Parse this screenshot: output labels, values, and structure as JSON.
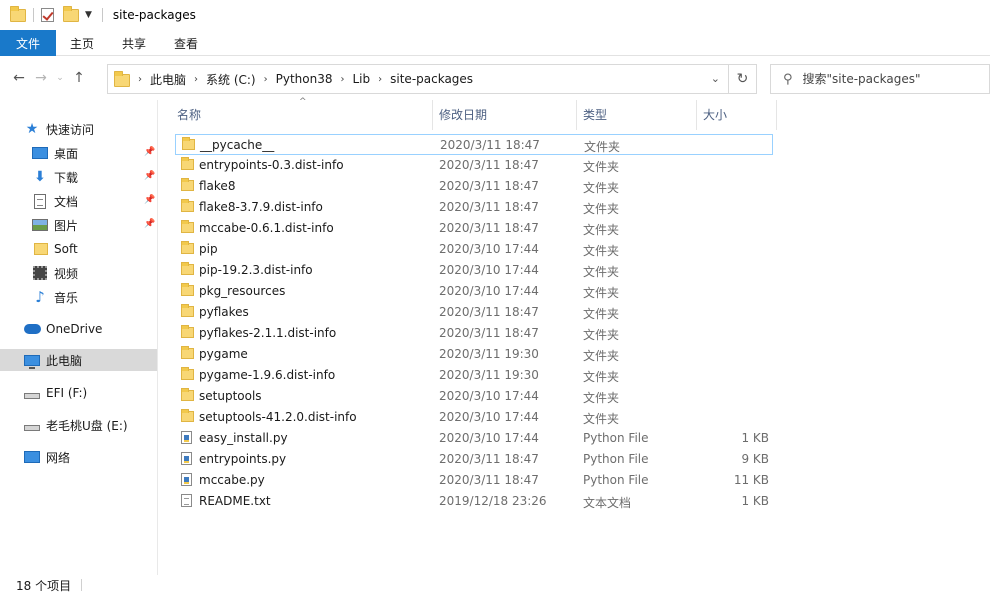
{
  "window": {
    "title": "site-packages"
  },
  "ribbon": {
    "tabs": [
      "文件",
      "主页",
      "共享",
      "查看"
    ]
  },
  "address": {
    "crumbs": [
      "此电脑",
      "系统 (C:)",
      "Python38",
      "Lib",
      "site-packages"
    ]
  },
  "search": {
    "placeholder": "搜索\"site-packages\""
  },
  "nav": {
    "quick_access": "快速访问",
    "items": [
      "桌面",
      "下载",
      "文档",
      "图片",
      "Soft",
      "视频",
      "音乐"
    ],
    "onedrive": "OneDrive",
    "this_pc": "此电脑",
    "drive_f": "EFI (F:)",
    "drive_e": "老毛桃U盘 (E:)",
    "network": "网络"
  },
  "columns": {
    "name": "名称",
    "date": "修改日期",
    "type": "类型",
    "size": "大小"
  },
  "files": [
    {
      "name": "__pycache__",
      "date": "2020/3/11 18:47",
      "type": "文件夹",
      "size": "",
      "icon": "folder"
    },
    {
      "name": "entrypoints-0.3.dist-info",
      "date": "2020/3/11 18:47",
      "type": "文件夹",
      "size": "",
      "icon": "folder"
    },
    {
      "name": "flake8",
      "date": "2020/3/11 18:47",
      "type": "文件夹",
      "size": "",
      "icon": "folder"
    },
    {
      "name": "flake8-3.7.9.dist-info",
      "date": "2020/3/11 18:47",
      "type": "文件夹",
      "size": "",
      "icon": "folder"
    },
    {
      "name": "mccabe-0.6.1.dist-info",
      "date": "2020/3/11 18:47",
      "type": "文件夹",
      "size": "",
      "icon": "folder"
    },
    {
      "name": "pip",
      "date": "2020/3/10 17:44",
      "type": "文件夹",
      "size": "",
      "icon": "folder"
    },
    {
      "name": "pip-19.2.3.dist-info",
      "date": "2020/3/10 17:44",
      "type": "文件夹",
      "size": "",
      "icon": "folder"
    },
    {
      "name": "pkg_resources",
      "date": "2020/3/10 17:44",
      "type": "文件夹",
      "size": "",
      "icon": "folder"
    },
    {
      "name": "pyflakes",
      "date": "2020/3/11 18:47",
      "type": "文件夹",
      "size": "",
      "icon": "folder"
    },
    {
      "name": "pyflakes-2.1.1.dist-info",
      "date": "2020/3/11 18:47",
      "type": "文件夹",
      "size": "",
      "icon": "folder"
    },
    {
      "name": "pygame",
      "date": "2020/3/11 19:30",
      "type": "文件夹",
      "size": "",
      "icon": "folder"
    },
    {
      "name": "pygame-1.9.6.dist-info",
      "date": "2020/3/11 19:30",
      "type": "文件夹",
      "size": "",
      "icon": "folder"
    },
    {
      "name": "setuptools",
      "date": "2020/3/10 17:44",
      "type": "文件夹",
      "size": "",
      "icon": "folder"
    },
    {
      "name": "setuptools-41.2.0.dist-info",
      "date": "2020/3/10 17:44",
      "type": "文件夹",
      "size": "",
      "icon": "folder"
    },
    {
      "name": "easy_install.py",
      "date": "2020/3/10 17:44",
      "type": "Python File",
      "size": "1 KB",
      "icon": "python-file"
    },
    {
      "name": "entrypoints.py",
      "date": "2020/3/11 18:47",
      "type": "Python File",
      "size": "9 KB",
      "icon": "python-file"
    },
    {
      "name": "mccabe.py",
      "date": "2020/3/11 18:47",
      "type": "Python File",
      "size": "11 KB",
      "icon": "python-file"
    },
    {
      "name": "README.txt",
      "date": "2019/12/18 23:26",
      "type": "文本文档",
      "size": "1 KB",
      "icon": "text-file"
    }
  ],
  "status": {
    "count": "18 个项目"
  },
  "colors": {
    "accent": "#1979ca",
    "selection_border": "#99d1ff",
    "folder": "#f8d775"
  }
}
